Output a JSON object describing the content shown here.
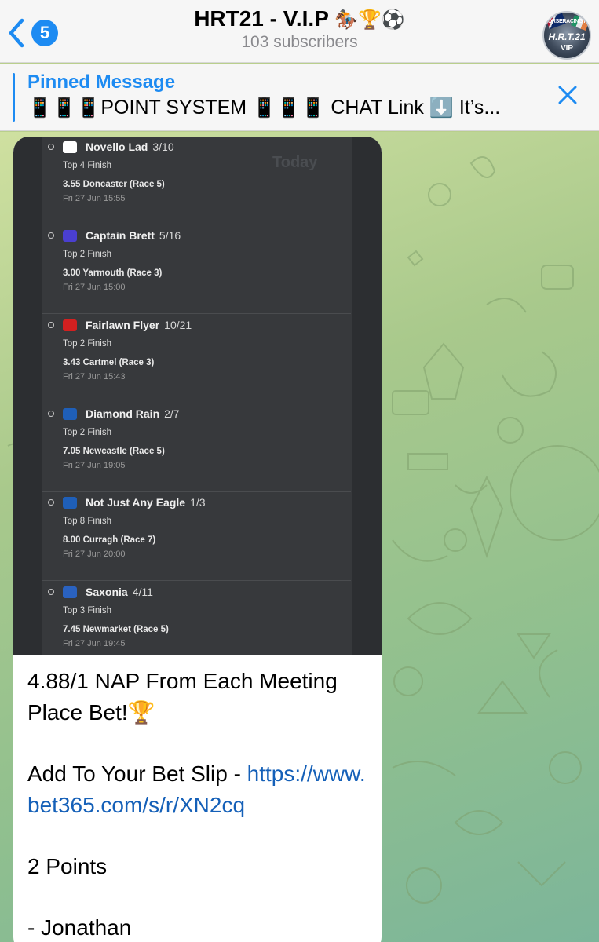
{
  "header": {
    "back_count": "5",
    "title": "HRT21 - V.I.P",
    "title_emojis": "🏇🏆⚽",
    "subtitle": "103 subscribers",
    "avatar": {
      "top": "HORSERACINGTIPS21",
      "mid": "H.R.T.21",
      "bot": "VIP"
    }
  },
  "pinned": {
    "title": "Pinned Message",
    "text": "📱📱📱POINT SYSTEM 📱📱📱 CHAT Link ⬇️ It’s..."
  },
  "message": {
    "screenshot": {
      "today_label": "Today",
      "selections": [
        {
          "name": "Novello Lad",
          "odds": "3/10",
          "market": "Top 4 Finish",
          "race": "3.55 Doncaster (Race 5)",
          "time": "Fri 27 Jun 15:55",
          "silk_color": "#ffffff"
        },
        {
          "name": "Captain Brett",
          "odds": "5/16",
          "market": "Top 2 Finish",
          "race": "3.00 Yarmouth (Race 3)",
          "time": "Fri 27 Jun 15:00",
          "silk_color": "#4a3fd0"
        },
        {
          "name": "Fairlawn Flyer",
          "odds": "10/21",
          "market": "Top 2 Finish",
          "race": "3.43 Cartmel (Race 3)",
          "time": "Fri 27 Jun 15:43",
          "silk_color": "#d32020"
        },
        {
          "name": "Diamond Rain",
          "odds": "2/7",
          "market": "Top 2 Finish",
          "race": "7.05 Newcastle (Race 5)",
          "time": "Fri 27 Jun 19:05",
          "silk_color": "#1f5fb8"
        },
        {
          "name": "Not Just Any Eagle",
          "odds": "1/3",
          "market": "Top 8 Finish",
          "race": "8.00 Curragh (Race 7)",
          "time": "Fri 27 Jun 20:00",
          "silk_color": "#1f5fb8"
        },
        {
          "name": "Saxonia",
          "odds": "4/11",
          "market": "Top 3 Finish",
          "race": "7.45 Newmarket (Race 5)",
          "time": "Fri 27 Jun 19:45",
          "silk_color": "#2a62c0"
        }
      ]
    },
    "line1": "4.88/1 NAP From Each Meeting Place Bet!🏆",
    "line2_prefix": "Add To Your Bet Slip - ",
    "link": "https://www.bet365.com/s/r/XN2cq",
    "line3": "2 Points",
    "line4": "- Jonathan"
  },
  "colors": {
    "accent": "#1d8bf2",
    "link": "#1560b8",
    "header_bg": "#f6f6f6"
  }
}
